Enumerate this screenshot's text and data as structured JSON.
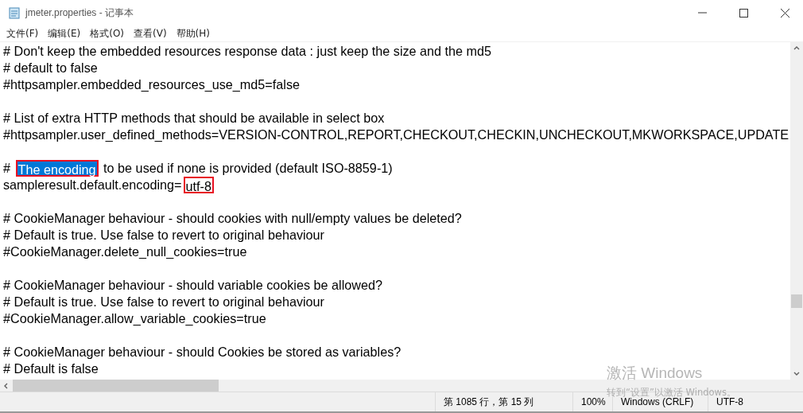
{
  "window": {
    "title": "jmeter.properties - 记事本"
  },
  "menu": [
    "文件(F)",
    "编辑(E)",
    "格式(O)",
    "查看(V)",
    "帮助(H)"
  ],
  "lines": [
    {
      "kind": "text",
      "segments": [
        {
          "text": "# Don't keep the embedded resources response data : just keep the size and the md5"
        }
      ]
    },
    {
      "kind": "text",
      "segments": [
        {
          "text": "# default to false"
        }
      ]
    },
    {
      "kind": "text",
      "segments": [
        {
          "text": "#httpsampler.embedded_resources_use_md5=false"
        }
      ]
    },
    {
      "kind": "blank"
    },
    {
      "kind": "text",
      "segments": [
        {
          "text": "# List of extra HTTP methods that should be available in select box"
        }
      ]
    },
    {
      "kind": "text",
      "segments": [
        {
          "text": "#httpsampler.user_defined_methods=VERSION-CONTROL,REPORT,CHECKOUT,CHECKIN,UNCHECKOUT,MKWORKSPACE,UPDATE"
        }
      ]
    },
    {
      "kind": "blank"
    },
    {
      "kind": "text",
      "segments": [
        {
          "text": "# ",
          "selected": false,
          "marked": false
        },
        {
          "text": "The encoding",
          "selected": true,
          "marked": true
        },
        {
          "text": " to be used if none is provided (default ISO-8859-1)",
          "selected": false,
          "marked": false
        }
      ]
    },
    {
      "kind": "text",
      "segments": [
        {
          "text": "sampleresult.default.encoding=",
          "selected": false,
          "marked": false
        },
        {
          "text": "utf-8",
          "selected": false,
          "marked": true
        }
      ]
    },
    {
      "kind": "blank"
    },
    {
      "kind": "text",
      "segments": [
        {
          "text": "# CookieManager behaviour - should cookies with null/empty values be deleted?"
        }
      ]
    },
    {
      "kind": "text",
      "segments": [
        {
          "text": "# Default is true. Use false to revert to original behaviour"
        }
      ]
    },
    {
      "kind": "text",
      "segments": [
        {
          "text": "#CookieManager.delete_null_cookies=true"
        }
      ]
    },
    {
      "kind": "blank"
    },
    {
      "kind": "text",
      "segments": [
        {
          "text": "# CookieManager behaviour - should variable cookies be allowed?"
        }
      ]
    },
    {
      "kind": "text",
      "segments": [
        {
          "text": "# Default is true. Use false to revert to original behaviour"
        }
      ]
    },
    {
      "kind": "text",
      "segments": [
        {
          "text": "#CookieManager.allow_variable_cookies=true"
        }
      ]
    },
    {
      "kind": "blank"
    },
    {
      "kind": "text",
      "segments": [
        {
          "text": "# CookieManager behaviour - should Cookies be stored as variables?"
        }
      ]
    },
    {
      "kind": "text",
      "segments": [
        {
          "text": "# Default is false"
        }
      ]
    }
  ],
  "status_bar": {
    "position": "第 1085 行，第 15 列",
    "zoom": "100%",
    "line_ending": "Windows (CRLF)",
    "encoding": "UTF-8"
  },
  "activation_notice": {
    "title": "激活 Windows",
    "message": "转到“设置”以激活 Windows。"
  }
}
